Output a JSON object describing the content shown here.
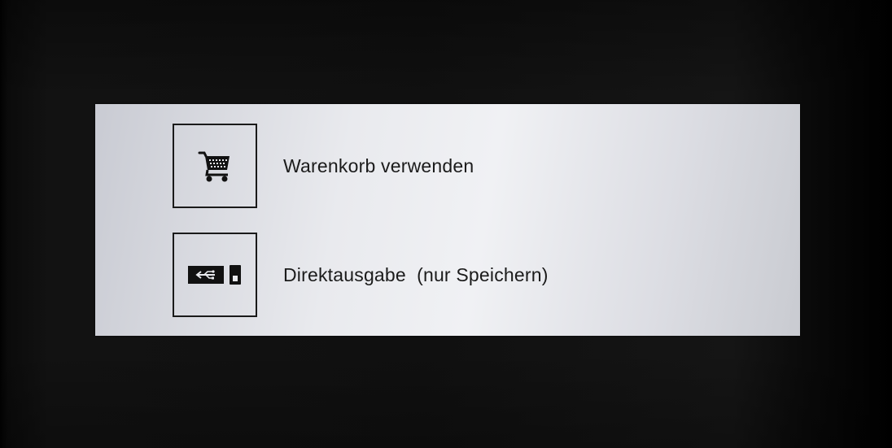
{
  "dialog": {
    "options": [
      {
        "label": "Warenkorb verwenden",
        "icon": "shopping-cart-icon"
      },
      {
        "label": "Direktausgabe  (nur Speichern)",
        "icon": "usb-device-icon"
      }
    ]
  }
}
